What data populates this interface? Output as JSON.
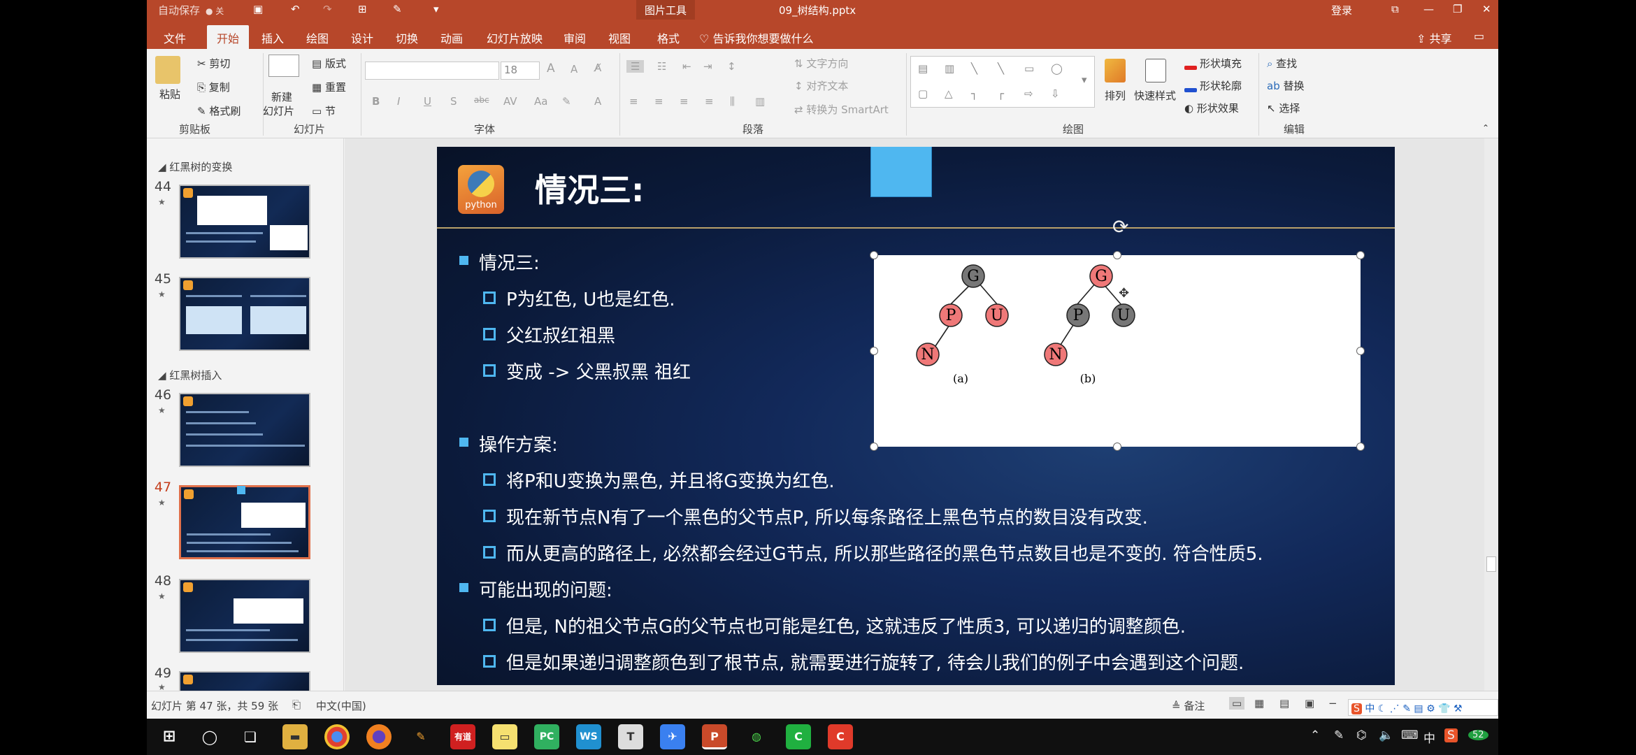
{
  "titlebar": {
    "autosave": "自动保存",
    "autosave_state": "关",
    "doc_title": "09_树结构.pptx",
    "context_tab": "图片工具",
    "login": "登录"
  },
  "tabs": [
    "文件",
    "开始",
    "插入",
    "绘图",
    "设计",
    "切换",
    "动画",
    "幻灯片放映",
    "审阅",
    "视图",
    "格式"
  ],
  "active_tab": "开始",
  "tell_me": "告诉我你想要做什么",
  "share": "共享",
  "ribbon": {
    "paste": "粘贴",
    "cut": "剪切",
    "copy": "复制",
    "format_painter": "格式刷",
    "clipboard": "剪贴板",
    "new_slide": "新建",
    "new_slide2": "幻灯片",
    "layout": "版式",
    "reset": "重置",
    "section": "节",
    "slides": "幻灯片",
    "font_size": "18",
    "font": "字体",
    "text_direction": "文字方向",
    "align_text": "对齐文本",
    "convert_smartart": "转换为 SmartArt",
    "paragraph": "段落",
    "arrange": "排列",
    "quick_styles": "快速样式",
    "shape_fill": "形状填充",
    "shape_outline": "形状轮廓",
    "shape_effects": "形状效果",
    "drawing": "绘图",
    "find": "查找",
    "replace": "替换",
    "select": "选择",
    "editing": "编辑",
    "font_btns": [
      "B",
      "I",
      "U",
      "S",
      "abc",
      "AV",
      "Aa",
      "A"
    ]
  },
  "panel": {
    "sections": [
      {
        "label": "红黑树的变换"
      },
      {
        "label": "红黑树插入"
      }
    ],
    "slides": [
      {
        "num": "44"
      },
      {
        "num": "45"
      },
      {
        "num": "46"
      },
      {
        "num": "47",
        "current": true
      },
      {
        "num": "48"
      },
      {
        "num": "49"
      }
    ]
  },
  "slide": {
    "logo_text": "python",
    "title": "情况三:",
    "bullets": [
      {
        "level": 1,
        "text": "情况三:"
      },
      {
        "level": 2,
        "text": "P为红色, U也是红色."
      },
      {
        "level": 2,
        "text": "父红叔红祖黑"
      },
      {
        "level": 2,
        "text": "变成 -> 父黑叔黑 祖红"
      },
      {
        "level": 1,
        "text": "操作方案:"
      },
      {
        "level": 2,
        "text": "将P和U变换为黑色, 并且将G变换为红色."
      },
      {
        "level": 2,
        "text": "现在新节点N有了一个黑色的父节点P, 所以每条路径上黑色节点的数目没有改变."
      },
      {
        "level": 2,
        "text": "而从更高的路径上, 必然都会经过G节点, 所以那些路径的黑色节点数目也是不变的. 符合性质5."
      },
      {
        "level": 1,
        "text": "可能出现的问题:"
      },
      {
        "level": 2,
        "text": "但是, N的祖父节点G的父节点也可能是红色, 这就违反了性质3, 可以递归的调整颜色."
      },
      {
        "level": 2,
        "text": "但是如果递归调整颜色到了根节点, 就需要进行旋转了, 待会儿我们的例子中会遇到这个问题."
      }
    ],
    "diagram": {
      "caption_a": "(a)",
      "caption_b": "(b)",
      "tree_a": {
        "G": "G",
        "P": "P",
        "U": "U",
        "N": "N"
      },
      "tree_b": {
        "G": "G",
        "P": "P",
        "U": "U",
        "N": "N"
      },
      "colors": {
        "red": "#ef7878",
        "black": "#777777"
      }
    }
  },
  "status": {
    "slide_info": "幻灯片 第 47 张，共 59 张",
    "language": "中文(中国)",
    "notes": "备注"
  },
  "taskbar": {
    "ime": "中",
    "clock": "52"
  },
  "colors": {
    "accent": "#b7472a",
    "slide_bg": "#12295a",
    "bullet": "#4fb7f0"
  }
}
